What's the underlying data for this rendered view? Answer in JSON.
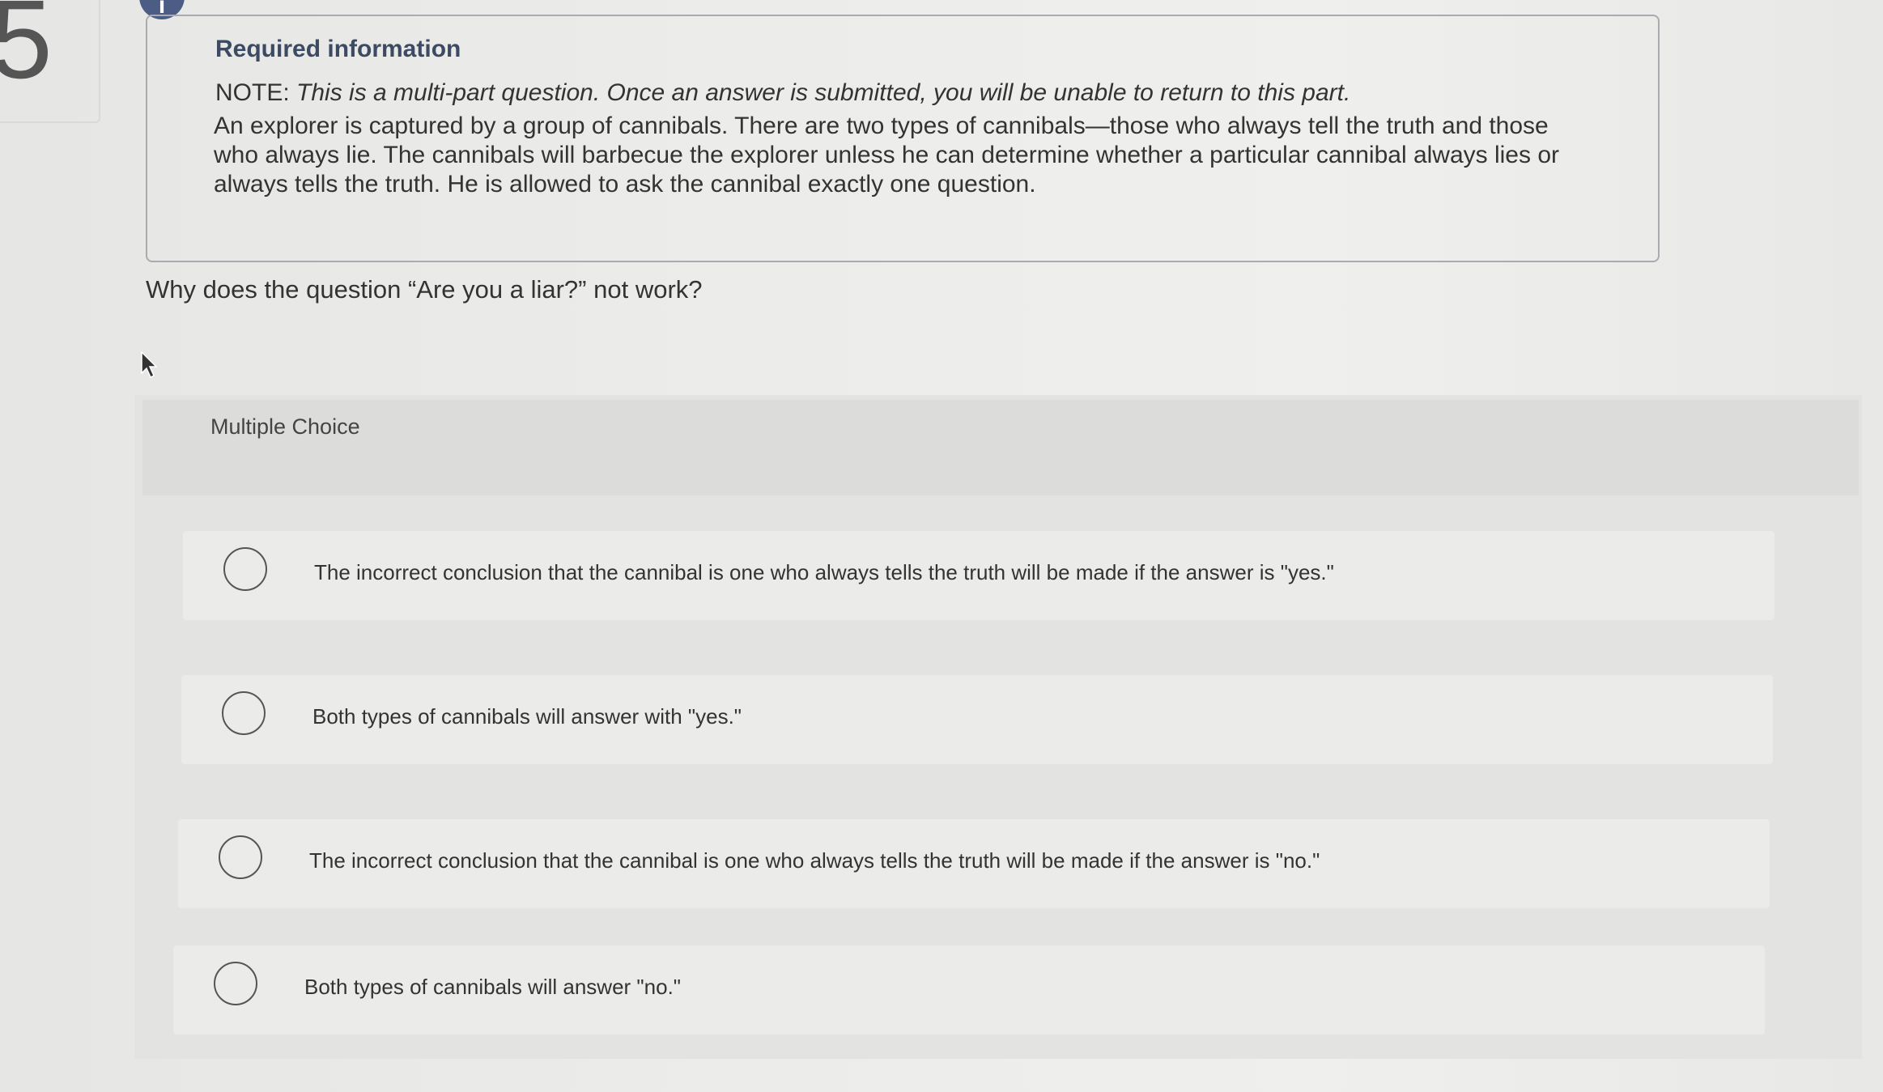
{
  "question": {
    "number": "5",
    "info_badge": "i",
    "required_title": "Required information",
    "note_label": "NOTE:",
    "note_text": "This is a multi-part question. Once an answer is submitted, you will be unable to return to this part.",
    "prompt": "An explorer is captured by a group of cannibals. There are two types of cannibals—those who always tell the truth and those who always lie. The cannibals will barbecue the explorer unless he can determine whether a particular cannibal always lies or always tells the truth. He is allowed to ask the cannibal exactly one question.",
    "question_text": "Why does the question “Are you a liar?” not work?"
  },
  "multiple_choice": {
    "label": "Multiple Choice",
    "options": [
      {
        "label": "The incorrect conclusion that the cannibal is one who always tells the truth will be made if the answer is \"yes.\"",
        "selected": false
      },
      {
        "label": "Both types of cannibals will answer with \"yes.\"",
        "selected": false
      },
      {
        "label": "The incorrect conclusion that the cannibal is one who always tells the truth will be made if the answer is \"no.\"",
        "selected": false
      },
      {
        "label": "Both types of cannibals will answer \"no.\"",
        "selected": false
      }
    ]
  },
  "colors": {
    "badge": "#4b5d85",
    "title": "#3d4a63",
    "panel": "#e3e3e1"
  }
}
